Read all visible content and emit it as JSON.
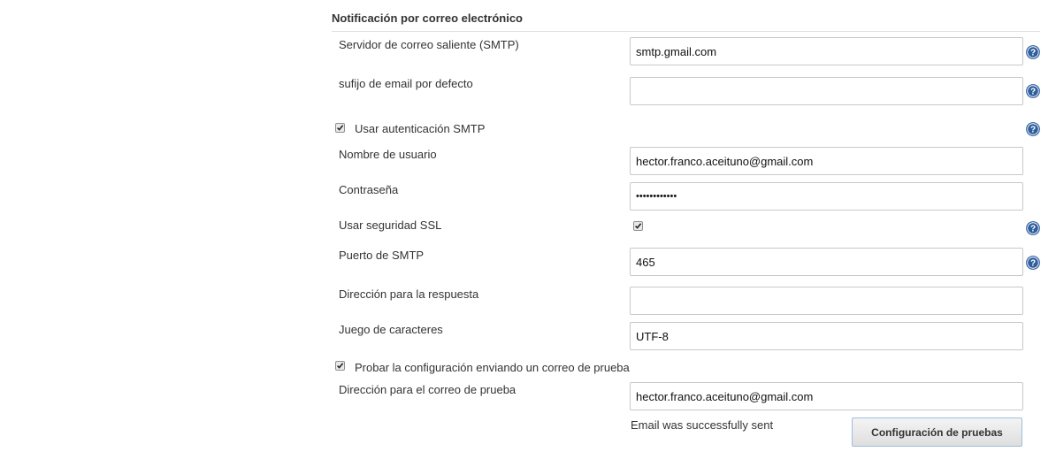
{
  "section": {
    "title": "Notificación por correo electrónico"
  },
  "smtp_server": {
    "label": "Servidor de correo saliente (SMTP)",
    "value": "smtp.gmail.com"
  },
  "email_suffix": {
    "label": "sufijo de email por defecto",
    "value": ""
  },
  "smtp_auth": {
    "label": "Usar autenticación SMTP",
    "checked": true
  },
  "username": {
    "label": "Nombre de usuario",
    "value": "hector.franco.aceituno@gmail.com"
  },
  "password": {
    "label": "Contraseña",
    "value": "••••••••••••"
  },
  "ssl": {
    "label": "Usar seguridad SSL",
    "checked": true
  },
  "smtp_port": {
    "label": "Puerto de SMTP",
    "value": "465"
  },
  "reply_to": {
    "label": "Dirección para la respuesta",
    "value": ""
  },
  "charset": {
    "label": "Juego de caracteres",
    "value": "UTF-8"
  },
  "test_config": {
    "label": "Probar la configuración enviando un correo de prueba",
    "checked": true
  },
  "test_address": {
    "label": "Dirección para el correo de prueba",
    "value": "hector.franco.aceituno@gmail.com"
  },
  "status_message": "Email was successfully sent",
  "test_button": {
    "label": "Configuración de pruebas"
  },
  "colors": {
    "help_icon": "#2f5e9e",
    "button_border": "#9fbedb"
  }
}
